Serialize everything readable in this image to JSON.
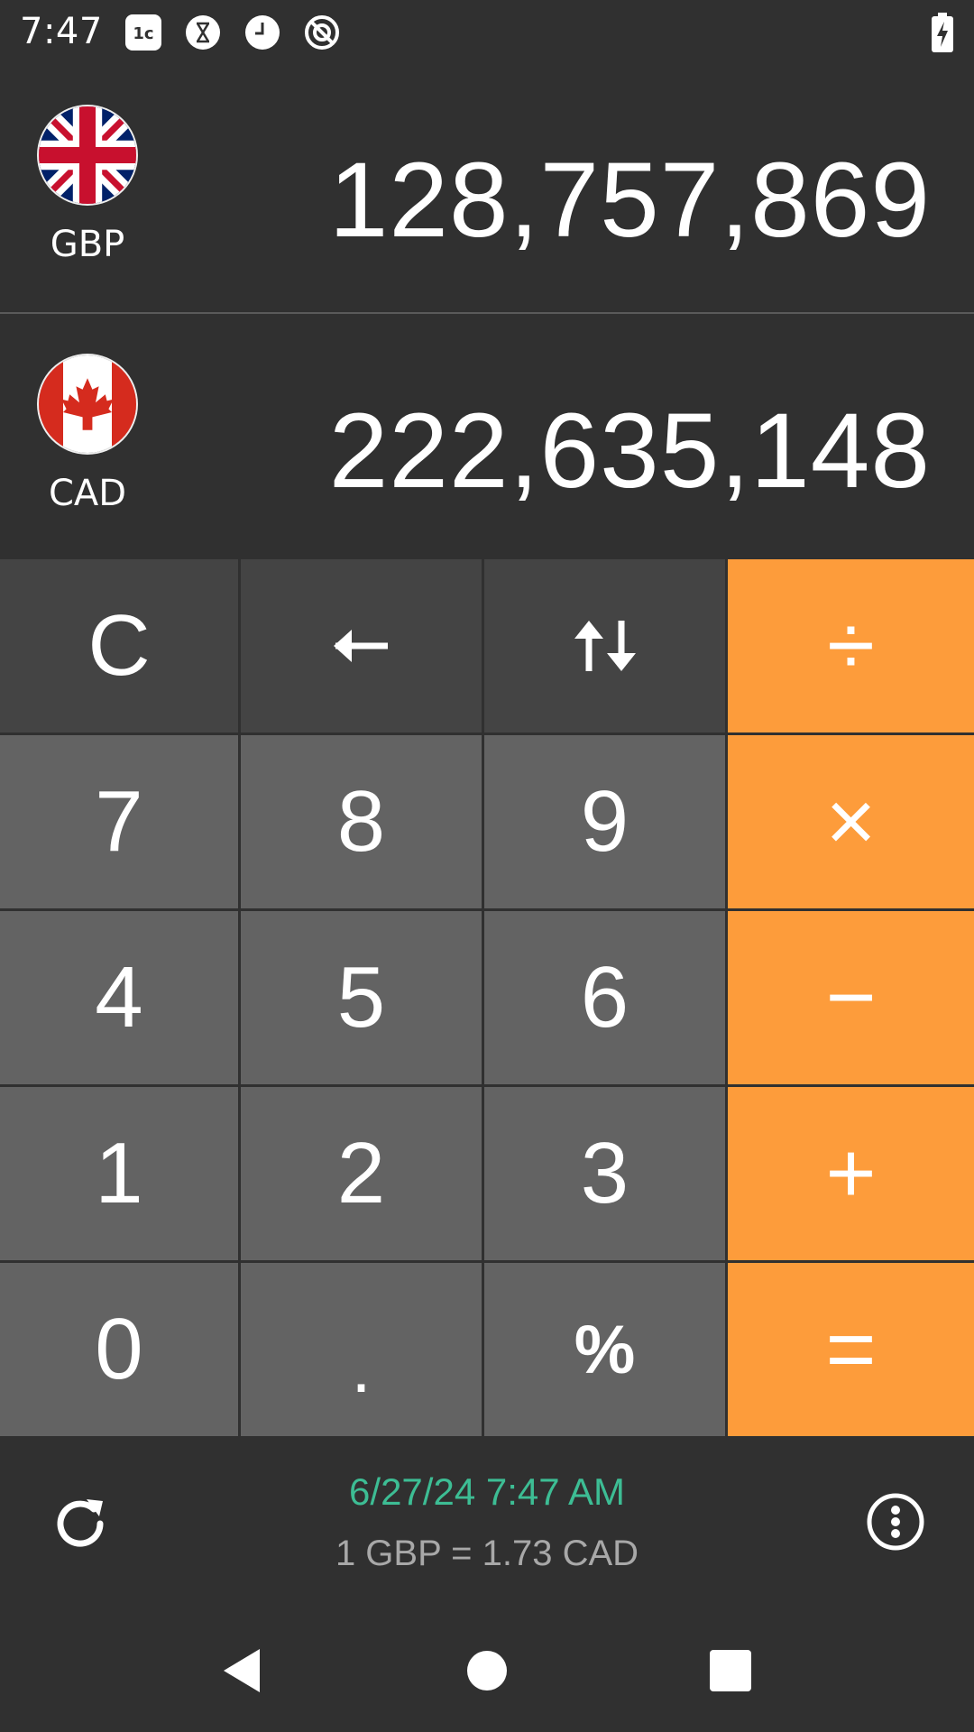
{
  "status_bar": {
    "time": "7:47",
    "icons": [
      "1c-icon",
      "hourglass-icon",
      "clock-icon",
      "no-data-icon"
    ],
    "battery_icon": "battery-charging-icon"
  },
  "converter": {
    "from": {
      "code": "GBP",
      "value": "128,757,869",
      "flag": "uk-flag-icon"
    },
    "to": {
      "code": "CAD",
      "value": "222,635,148",
      "flag": "canada-flag-icon"
    }
  },
  "keypad": {
    "clear": "C",
    "backspace": "←",
    "swap": "↑↓",
    "divide": "÷",
    "seven": "7",
    "eight": "8",
    "nine": "9",
    "multiply": "×",
    "four": "4",
    "five": "5",
    "six": "6",
    "minus": "−",
    "one": "1",
    "two": "2",
    "three": "3",
    "plus": "+",
    "zero": "0",
    "dot": ".",
    "percent": "%",
    "equals": "="
  },
  "info": {
    "updated": "6/27/24 7:47 AM",
    "rate": "1 GBP = 1.73 CAD"
  },
  "colors": {
    "background": "#303030",
    "operator": "#fd9c3b",
    "key_dark": "#444444",
    "key_gray": "#636363",
    "updated_text": "#3dbd94",
    "rate_text": "#a8a8a8"
  }
}
